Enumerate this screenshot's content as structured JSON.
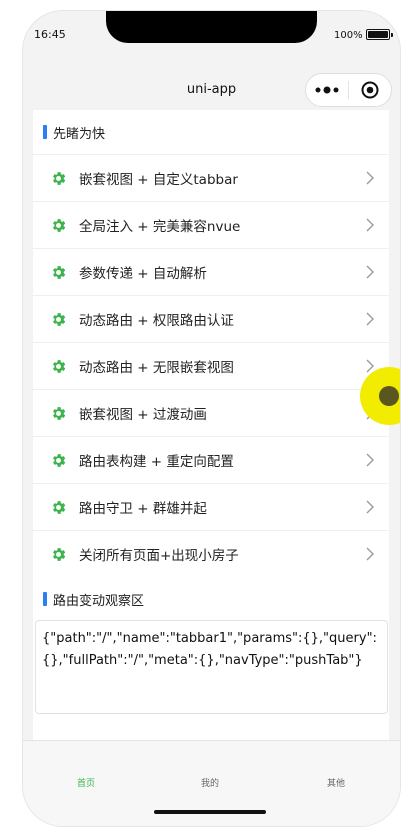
{
  "status_bar": {
    "time": "16:45",
    "battery_percent": "100%"
  },
  "navbar": {
    "title": "uni-app"
  },
  "section1": {
    "title": "先睹为快"
  },
  "items": [
    {
      "label": "嵌套视图 + 自定义tabbar"
    },
    {
      "label": "全局注入 + 完美兼容nvue"
    },
    {
      "label": "参数传递 + 自动解析"
    },
    {
      "label": "动态路由 + 权限路由认证"
    },
    {
      "label": "动态路由 + 无限嵌套视图"
    },
    {
      "label": "嵌套视图 + 过渡动画"
    },
    {
      "label": "路由表构建 + 重定向配置"
    },
    {
      "label": "路由守卫 + 群雄并起"
    },
    {
      "label": "关闭所有页面+出现小房子"
    }
  ],
  "section2": {
    "title": "路由变动观察区",
    "content": "{\"path\":\"/\",\"name\":\"tabbar1\",\"params\":{},\"query\":{},\"fullPath\":\"/\",\"meta\":{},\"navType\":\"pushTab\"}"
  },
  "tabbar": {
    "home": "首页",
    "mine": "我的",
    "other": "其他"
  },
  "colors": {
    "accent_blue": "#2d7df6",
    "icon_green": "#3cb44b",
    "touch_marker": "#f2ec00"
  },
  "icons": {
    "item_icon": "gear-icon",
    "item_chevron": "chevron-right-icon"
  }
}
